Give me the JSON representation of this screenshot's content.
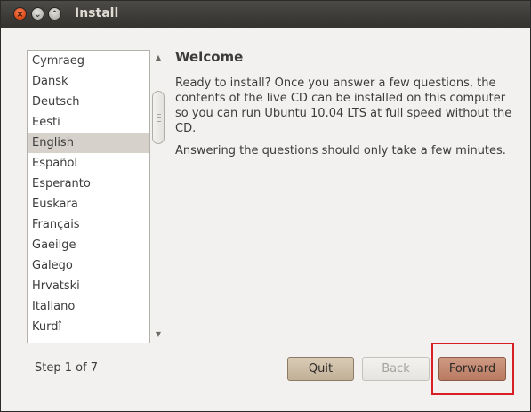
{
  "window": {
    "title": "Install",
    "controls": {
      "close": "×",
      "minimize": "⌄",
      "maximize": "⌃"
    }
  },
  "language_list": {
    "items": [
      "Cymraeg",
      "Dansk",
      "Deutsch",
      "Eesti",
      "English",
      "Español",
      "Esperanto",
      "Euskara",
      "Français",
      "Gaeilge",
      "Galego",
      "Hrvatski",
      "Italiano",
      "Kurdî"
    ],
    "selected": "English"
  },
  "content": {
    "heading": "Welcome",
    "paragraph1": "Ready to install?  Once you answer a few questions, the contents of the live CD can be installed on this computer so you can run Ubuntu 10.04 LTS at full speed without the CD.",
    "paragraph2": "Answering the questions should only take a few minutes."
  },
  "footer": {
    "step": "Step 1 of 7",
    "quit_label": "Quit",
    "back_label": "Back",
    "forward_label": "Forward"
  },
  "colors": {
    "titlebar": "#3c3b37",
    "selection": "#d6d2cb",
    "forward_button": "#c48a72",
    "highlight": "#d81f26"
  }
}
